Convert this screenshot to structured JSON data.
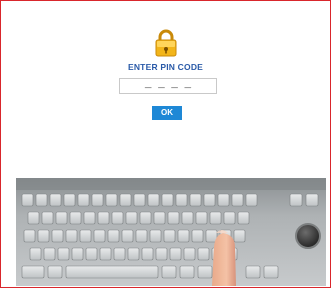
{
  "prompt": {
    "title": "ENTER PIN CODE"
  },
  "pin": {
    "value": "_ _ _ _"
  },
  "actions": {
    "ok_label": "OK"
  },
  "colors": {
    "accent": "#1e88d6",
    "title": "#2a5aa8",
    "lock": "#f2b51a",
    "border": "#d9262c"
  },
  "icons": {
    "lock": "padlock-icon"
  }
}
